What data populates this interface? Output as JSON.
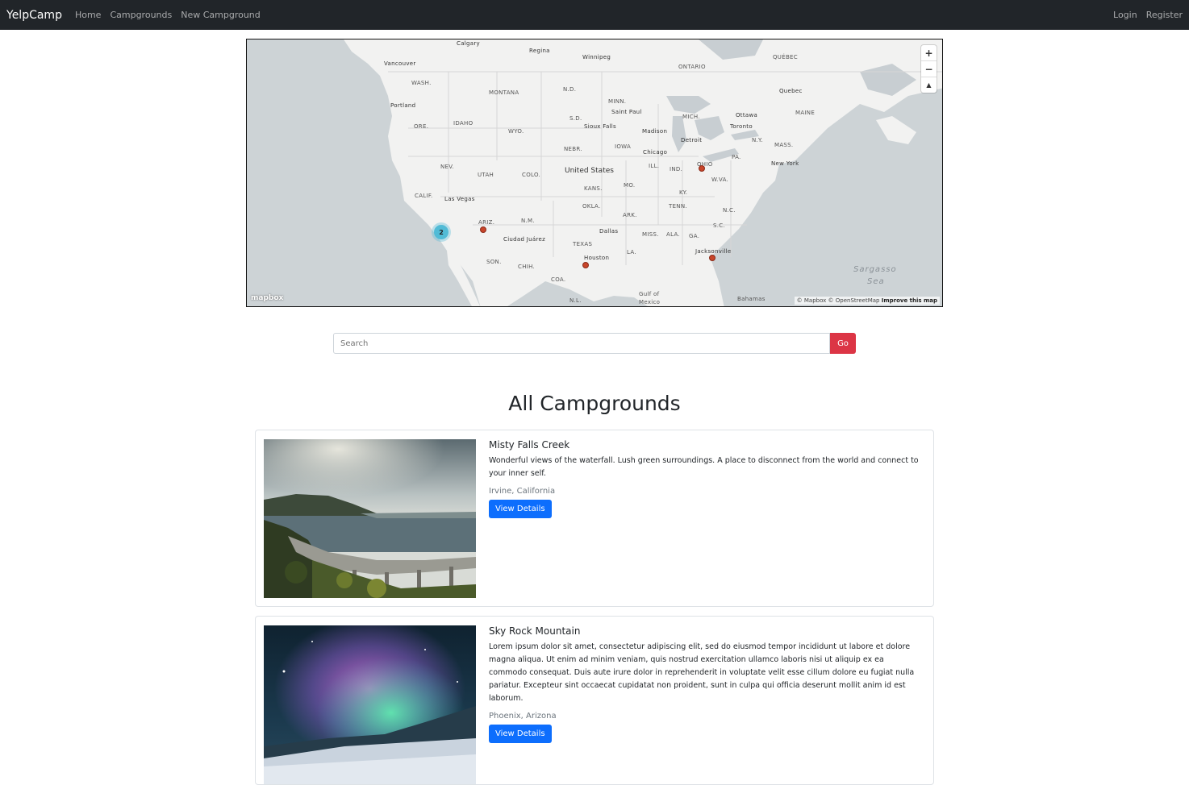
{
  "navbar": {
    "brand": "YelpCamp",
    "links": [
      "Home",
      "Campgrounds",
      "New Campground"
    ],
    "right_links": [
      "Login",
      "Register"
    ]
  },
  "map": {
    "zoom_in": "+",
    "zoom_out": "−",
    "compass": "▲",
    "cluster_count": "2",
    "logo": "mapbox",
    "attribution": "© Mapbox © OpenStreetMap",
    "improve": "Improve this map",
    "labels": {
      "calgary": "Calgary",
      "regina": "Regina",
      "winnipeg": "Winnipeg",
      "ontario": "ONTARIO",
      "quebec_prov": "QUÉBEC",
      "vancouver": "Vancouver",
      "wash": "WASH.",
      "montana": "MONTANA",
      "nd": "N.D.",
      "minn": "MINN.",
      "quebec_city": "Quebec",
      "portland": "Portland",
      "idaho": "IDAHO",
      "saint_paul": "Saint Paul",
      "mich": "MICH.",
      "ottawa": "Ottawa",
      "maine": "MAINE",
      "ore": "ORE.",
      "wyo": "WYO.",
      "sd": "S.D.",
      "sioux_falls": "Sioux Falls",
      "madison": "Madison",
      "toronto": "Toronto",
      "ny": "N.Y.",
      "mass": "MASS.",
      "detroit": "Detroit",
      "nebr": "NEBR.",
      "iowa": "IOWA",
      "chicago": "Chicago",
      "pa": "PA.",
      "nev": "NEV.",
      "utah": "UTAH",
      "colo": "COLO.",
      "united_states": "United States",
      "ill": "ILL.",
      "ind": "IND.",
      "ohio": "OHIO",
      "new_york": "New York",
      "calif": "CALIF.",
      "kans": "KANS.",
      "mo": "MO.",
      "ky": "KY.",
      "wva": "W.VA.",
      "las_vegas": "Las Vegas",
      "okla": "OKLA.",
      "tenn": "TENN.",
      "nc": "N.C.",
      "ariz": "ARIZ.",
      "nm": "N.M.",
      "ark": "ARK.",
      "sc": "S.C.",
      "dallas": "Dallas",
      "ciudad_juarez": "Ciudad Juárez",
      "miss": "MISS.",
      "ala": "ALA.",
      "ga": "GA.",
      "texas": "TEXAS",
      "son": "SON.",
      "chih": "CHIH.",
      "houston": "Houston",
      "la": "LA.",
      "jacksonville": "Jacksonville",
      "sargasso": "Sargasso",
      "sea": "Sea",
      "coa": "COA.",
      "gulf_of": "Gulf of",
      "mexico": "Mexico",
      "bahamas": "Bahamas",
      "nl": "N.L."
    }
  },
  "search": {
    "placeholder": "Search",
    "button": "Go"
  },
  "page_title": "All Campgrounds",
  "campgrounds": [
    {
      "title": "Misty Falls Creek",
      "description": "Wonderful views of the waterfall. Lush green surroundings. A place to disconnect from the world and connect to your inner self.",
      "location": "Irvine, California",
      "button": "View Details"
    },
    {
      "title": "Sky Rock Mountain",
      "description": "Lorem ipsum dolor sit amet, consectetur adipiscing elit, sed do eiusmod tempor incididunt ut labore et dolore magna aliqua. Ut enim ad minim veniam, quis nostrud exercitation ullamco laboris nisi ut aliquip ex ea commodo consequat. Duis aute irure dolor in reprehenderit in voluptate velit esse cillum dolore eu fugiat nulla pariatur. Excepteur sint occaecat cupidatat non proident, sunt in culpa qui officia deserunt mollit anim id est laborum.",
      "location": "Phoenix, Arizona",
      "button": "View Details"
    }
  ]
}
